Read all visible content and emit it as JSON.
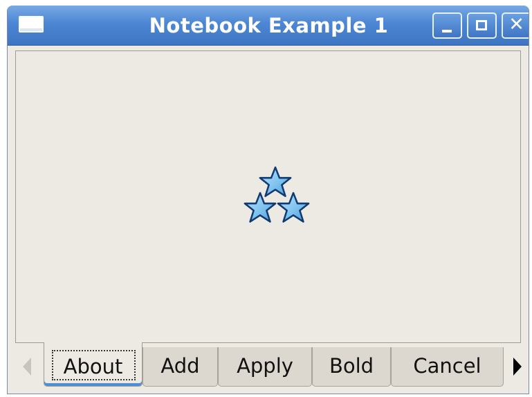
{
  "window": {
    "title": "Notebook Example 1"
  },
  "window_controls": {
    "minimize": "minimize-icon",
    "maximize": "maximize-icon",
    "close": "close-icon"
  },
  "content": {
    "icon": "stars-icon"
  },
  "tabs": [
    {
      "label": "About",
      "active": true
    },
    {
      "label": "Add",
      "active": false
    },
    {
      "label": "Apply",
      "active": false
    },
    {
      "label": "Bold",
      "active": false
    },
    {
      "label": "Cancel",
      "active": false
    }
  ],
  "scroll_arrows": {
    "left": "chevron-left-icon",
    "right": "chevron-right-icon"
  },
  "colors": {
    "titlebar": "#4c86d4",
    "window_bg": "#edeae4",
    "tab_bg": "#ddd8cf",
    "star_fill": "#8ecdf4",
    "star_outline": "#123b73"
  }
}
